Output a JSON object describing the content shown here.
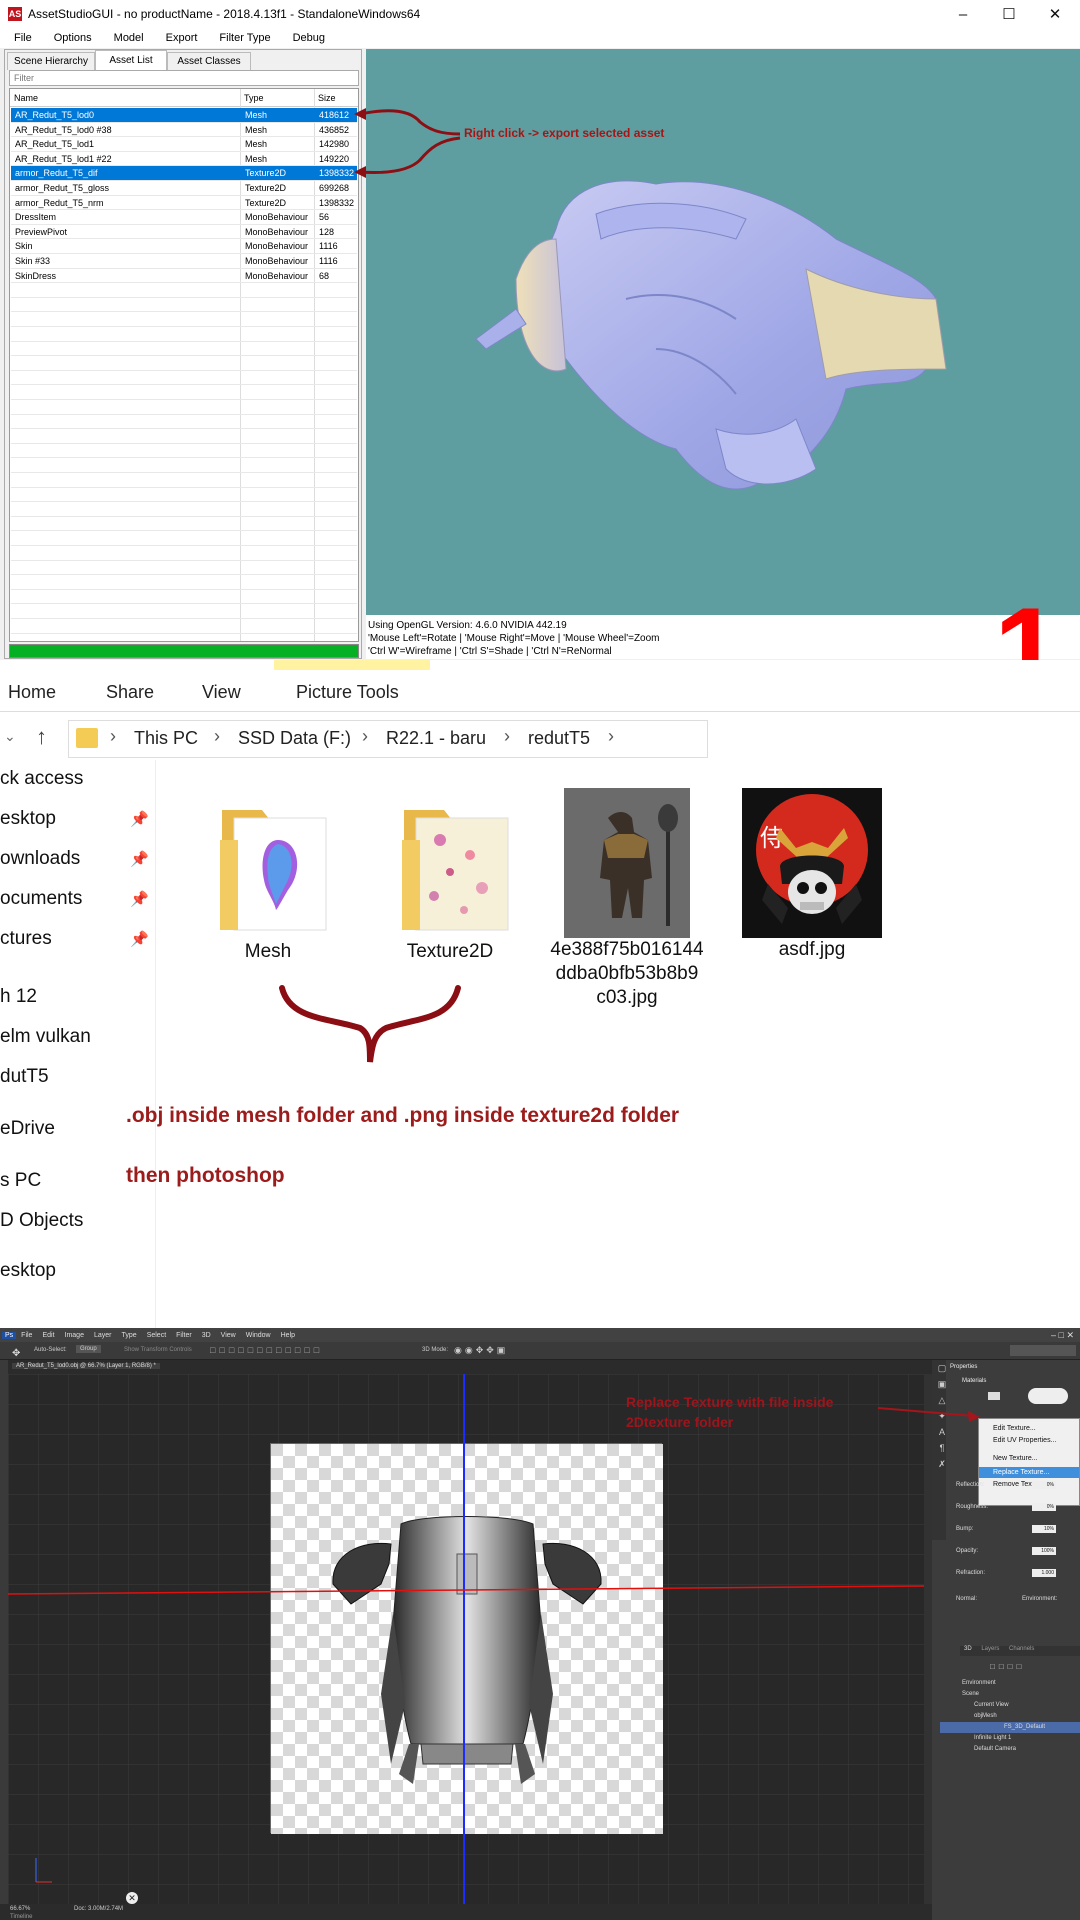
{
  "assetstudio": {
    "window_title": "AssetStudioGUI - no productName - 2018.4.13f1 - StandaloneWindows64",
    "logo_text": "AS",
    "menu": [
      "File",
      "Options",
      "Model",
      "Export",
      "Filter Type",
      "Debug"
    ],
    "tabs": [
      "Scene Hierarchy",
      "Asset List",
      "Asset Classes"
    ],
    "active_tab": "Asset List",
    "filter_placeholder": "Filter",
    "columns": [
      "Name",
      "Type",
      "Size"
    ],
    "rows": [
      {
        "name": "AR_Redut_T5_lod0",
        "type": "Mesh",
        "size": "418612",
        "selected": true
      },
      {
        "name": "AR_Redut_T5_lod0 #38",
        "type": "Mesh",
        "size": "436852",
        "selected": false
      },
      {
        "name": "AR_Redut_T5_lod1",
        "type": "Mesh",
        "size": "142980",
        "selected": false
      },
      {
        "name": "AR_Redut_T5_lod1 #22",
        "type": "Mesh",
        "size": "149220",
        "selected": false
      },
      {
        "name": "armor_Redut_T5_dif",
        "type": "Texture2D",
        "size": "1398332",
        "selected": true
      },
      {
        "name": "armor_Redut_T5_gloss",
        "type": "Texture2D",
        "size": "699268",
        "selected": false
      },
      {
        "name": "armor_Redut_T5_nrm",
        "type": "Texture2D",
        "size": "1398332",
        "selected": false
      },
      {
        "name": "DressItem",
        "type": "MonoBehaviour",
        "size": "56",
        "selected": false
      },
      {
        "name": "PreviewPivot",
        "type": "MonoBehaviour",
        "size": "128",
        "selected": false
      },
      {
        "name": "Skin",
        "type": "MonoBehaviour",
        "size": "1116",
        "selected": false
      },
      {
        "name": "Skin #33",
        "type": "MonoBehaviour",
        "size": "1116",
        "selected": false
      },
      {
        "name": "SkinDress",
        "type": "MonoBehaviour",
        "size": "68",
        "selected": false
      }
    ],
    "progress": 1.0,
    "status_line1": "Using OpenGL Version: 4.6.0 NVIDIA 442.19",
    "status_line2": "'Mouse Left'=Rotate | 'Mouse Right'=Move | 'Mouse Wheel'=Zoom",
    "status_line3": "'Ctrl W'=Wireframe | 'Ctrl S'=Shade | 'Ctrl N'=ReNormal",
    "annotation": "Right click -> export selected asset",
    "step_number": "1",
    "viewport_bg": "#5f9ea0",
    "selection_color": "#0078d7",
    "annotation_color": "#a51515"
  },
  "explorer": {
    "ribbon_tabs": [
      "Home",
      "Share",
      "View",
      "Picture Tools"
    ],
    "breadcrumb": [
      "This PC",
      "SSD Data (F:)",
      "R22.1 - baru",
      "redutT5"
    ],
    "nav_items": [
      "ck access",
      "esktop",
      "ownloads",
      "ocuments",
      "ctures",
      "h 12",
      "elm vulkan",
      "dutT5",
      "eDrive",
      "s PC",
      "D Objects",
      "esktop"
    ],
    "files": [
      {
        "name": "Mesh",
        "kind": "folder-icon"
      },
      {
        "name": "Texture2D",
        "kind": "folder-icon"
      },
      {
        "name_lines": [
          "4e388f75b016144",
          "ddba0bfb53b8b9",
          "c03.jpg"
        ],
        "kind": "image-thumbnail"
      },
      {
        "name": "asdf.jpg",
        "kind": "image-thumbnail"
      }
    ],
    "thumb_glyph": "侍",
    "annotation1": ".obj inside mesh folder and .png inside texture2d folder",
    "annotation2": "then photoshop",
    "annotation_color": "#9c1b1b"
  },
  "photoshop": {
    "menu": [
      "File",
      "Edit",
      "Image",
      "Layer",
      "Type",
      "Select",
      "Filter",
      "3D",
      "View",
      "Window",
      "Help"
    ],
    "options": [
      "Auto-Select:",
      "Group",
      "Show Transform Controls",
      "3D Mode:"
    ],
    "doc_tab": "AR_Redut_T5_lod0.obj @ 66.7% (Layer 1, RGB/8) *",
    "annotation_line1": "Replace Texture with file inside",
    "annotation_line2": "2Dtexture folder",
    "properties_title": "Properties",
    "materials_label": "Materials",
    "context_menu": [
      "Edit Texture...",
      "Edit UV Properties...",
      "New Texture...",
      "Replace Texture...",
      "Remove Texture"
    ],
    "context_highlight": "Replace Texture...",
    "props": [
      {
        "label": "Reflection:",
        "value": "0%"
      },
      {
        "label": "Roughness:",
        "value": "0%"
      },
      {
        "label": "Bump:",
        "value": "10%"
      },
      {
        "label": "Opacity:",
        "value": "100%"
      },
      {
        "label": "Refraction:",
        "value": "1.000"
      }
    ],
    "normal_label": "Normal:",
    "environment_label": "Environment:",
    "panel_tabs": [
      "3D",
      "Layers",
      "Channels"
    ],
    "layers": [
      "Environment",
      "Scene",
      "Current View",
      "objMesh",
      "FS_3D_Default",
      "Infinite Light 1",
      "Default Camera"
    ],
    "layer_highlight": "FS_3D_Default",
    "status_zoom": "66.67%",
    "status_doc": "Doc: 3.00M/2.74M",
    "timeline_label": "Timeline",
    "annotation_color": "#b3111a"
  }
}
